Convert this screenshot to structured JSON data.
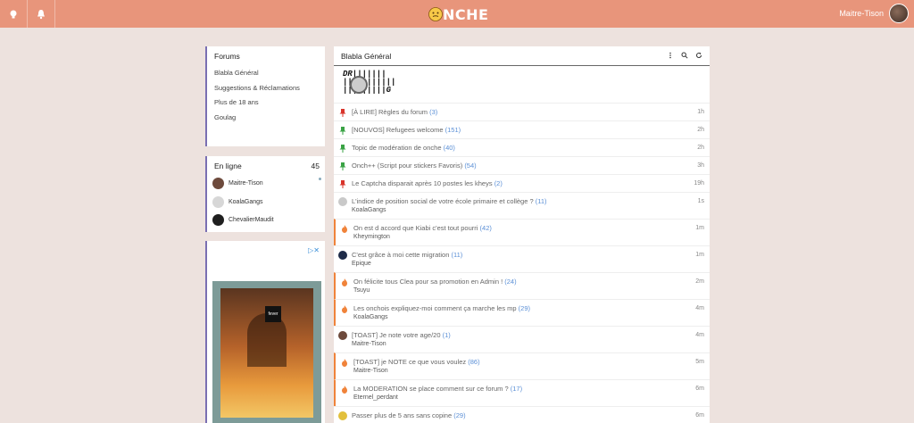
{
  "header": {
    "logo_text": "NCHE",
    "username": "Maitre-Tison",
    "icons": [
      "lightbulb-icon",
      "bell-icon"
    ]
  },
  "forums": {
    "title": "Forums",
    "items": [
      "Blabla Général",
      "Suggestions & Réclamations",
      "Plus de 18 ans",
      "Goulag"
    ]
  },
  "online": {
    "title": "En ligne",
    "count": "45",
    "users": [
      {
        "name": "Maitre-Tison",
        "avatar": "#6d4a3c"
      },
      {
        "name": "KoalaGangs",
        "avatar": "#d7d7d7"
      },
      {
        "name": "ChevalierMaudit",
        "avatar": "#1f1f1f"
      }
    ]
  },
  "ad": {
    "brand": "fever"
  },
  "main": {
    "title": "Blabla Général",
    "banner_lines": [
      "DR|||||||",
      "|||||||||||",
      "|||||||||G"
    ],
    "topics": [
      {
        "icon": "pin-red",
        "title": "[À LIRE] Règles du forum",
        "count": "(3)",
        "author": "",
        "time": "1h"
      },
      {
        "icon": "pin-green",
        "title": "[NOUVOS] Refugees welcome",
        "count": "(151)",
        "author": "",
        "time": "2h"
      },
      {
        "icon": "pin-green",
        "title": "Topic de modération de onche",
        "count": "(40)",
        "author": "",
        "time": "2h"
      },
      {
        "icon": "pin-green",
        "title": "Onch++ (Script pour stickers Favoris)",
        "count": "(54)",
        "author": "",
        "time": "3h"
      },
      {
        "icon": "pin-red",
        "title": "Le Captcha disparait après 10 postes les kheys",
        "count": "(2)",
        "author": "",
        "time": "19h"
      },
      {
        "icon": "avatar-grey",
        "title": "L'indice de position social de votre école primaire et collège ?",
        "count": "(11)",
        "author": "KoalaGangs",
        "time": "1s"
      },
      {
        "icon": "fire",
        "title": "On est d accord que Kiabi c'est tout pourri",
        "count": "(42)",
        "author": "Kheymington",
        "time": "1m"
      },
      {
        "icon": "avatar-dark",
        "title": "C'est grâce à moi cette migration",
        "count": "(11)",
        "author": "Epique",
        "time": "1m"
      },
      {
        "icon": "fire",
        "title": "On félicite tous Clea pour sa promotion en Admin !",
        "count": "(24)",
        "author": "Tsuyu",
        "time": "2m"
      },
      {
        "icon": "fire",
        "title": "Les onchois expliquez-moi comment ça marche les mp",
        "count": "(29)",
        "author": "KoalaGangs",
        "time": "4m"
      },
      {
        "icon": "avatar-brown",
        "title": "[TOAST] Je note votre age/20",
        "count": "(1)",
        "author": "Maitre-Tison",
        "time": "4m"
      },
      {
        "icon": "fire",
        "title": "[TOAST] je NOTE ce que vous voulez",
        "count": "(86)",
        "author": "Maitre-Tison",
        "time": "5m"
      },
      {
        "icon": "fire",
        "title": "La MODERATION se place comment sur ce forum ?",
        "count": "(17)",
        "author": "Eternel_perdant",
        "time": "6m"
      },
      {
        "icon": "avatar-yellow",
        "title": "Passer plus de 5 ans sans copine",
        "count": "(29)",
        "author": "",
        "time": "6m"
      }
    ]
  }
}
